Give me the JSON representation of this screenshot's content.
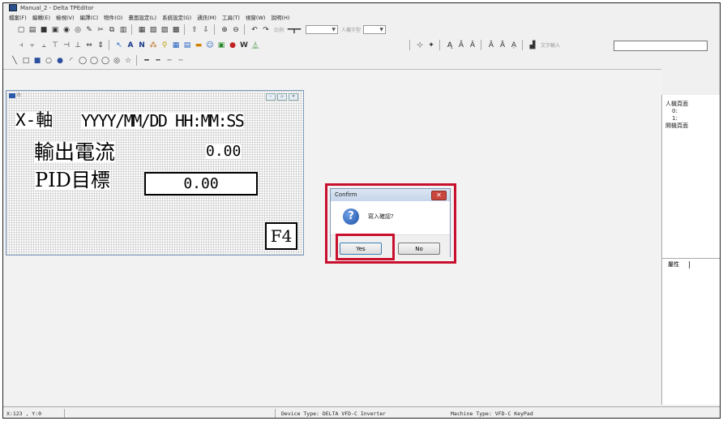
{
  "window": {
    "title": "Manual_2 - Delta TPEditor"
  },
  "menu": [
    "檔案(F)",
    "編輯(E)",
    "檢視(V)",
    "編譯(C)",
    "物件(O)",
    "畫面設定(L)",
    "系統設定(G)",
    "通訊(M)",
    "工具(T)",
    "視窗(W)",
    "說明(H)"
  ],
  "toolbar": {
    "zoom_label": "比例",
    "font_label": "人機字型",
    "text_input_label": "文字輸入"
  },
  "screen_window": {
    "label": "0:",
    "line1_axis": "X-軸",
    "line1_date": "YYYY/MM/DD HH:MM:SS",
    "line2_label": "輸出電流",
    "line2_value": "0.00",
    "line3_label": "PID目標",
    "line3_value": "0.00",
    "key_label": "F4"
  },
  "dialog": {
    "title": "Confirm",
    "message": "寫入確認?",
    "yes_label": "Yes",
    "no_label": "No"
  },
  "tree": {
    "root": "人機頁面",
    "child0": "0:",
    "child1": "1:",
    "root2": "開機頁面"
  },
  "properties": {
    "label": "屬性"
  },
  "status": {
    "coords": "X:123 , Y:0",
    "device": "Device Type: DELTA VFD-C Inverter",
    "machine": "Machine Type: VFD-C KeyPad"
  },
  "colors": {
    "highlight": "#c8102e",
    "close_button": "#c9463d"
  }
}
